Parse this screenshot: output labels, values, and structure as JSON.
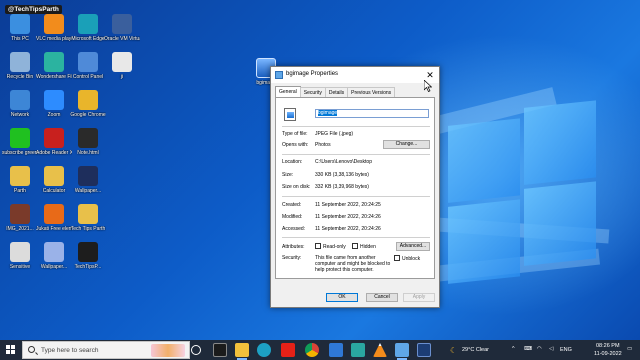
{
  "watermark": "@TechTipsParth",
  "desktop": {
    "icons": [
      {
        "label": "This PC",
        "icon": "this-pc-icon",
        "color": "#3b8fe0"
      },
      {
        "label": "VLC media player",
        "icon": "vlc-icon",
        "color": "#f28c1c"
      },
      {
        "label": "Microsoft Edge",
        "icon": "edge-icon",
        "color": "#1aa0b8"
      },
      {
        "label": "Oracle VM VirtualBox",
        "icon": "virtualbox-icon",
        "color": "#3a5f9d"
      },
      {
        "label": "Recycle Bin",
        "icon": "recycle-bin-icon",
        "color": "#8fb3d9"
      },
      {
        "label": "Wondershare Filmora",
        "icon": "filmora-icon",
        "color": "#2bb3a0"
      },
      {
        "label": "Control Panel",
        "icon": "control-panel-icon",
        "color": "#4f8ad8"
      },
      {
        "label": "ji",
        "icon": "file-icon",
        "color": "#e8e8e8"
      },
      {
        "label": "Network",
        "icon": "network-icon",
        "color": "#3d86d6"
      },
      {
        "label": "Zoom",
        "icon": "zoom-icon",
        "color": "#2d8cff"
      },
      {
        "label": "Google Chrome",
        "icon": "chrome-icon",
        "color": "#e9b52b"
      },
      {
        "label": "subscribe green screen",
        "icon": "image-icon",
        "color": "#20c020"
      },
      {
        "label": "Adobe Reader XI",
        "icon": "adobe-reader-icon",
        "color": "#c8201e"
      },
      {
        "label": "Note.html",
        "icon": "html-file-icon",
        "color": "#2a2a2a"
      },
      {
        "label": "Parth",
        "icon": "folder-icon",
        "color": "#e8c04a"
      },
      {
        "label": "Calculator",
        "icon": "calculator-icon",
        "color": "#e8c04a"
      },
      {
        "label": "Wallpaper...",
        "icon": "wallpaper-icon",
        "color": "#1e2e5c"
      },
      {
        "label": "IMG_2021...",
        "icon": "photo-icon",
        "color": "#7a3a2a"
      },
      {
        "label": "Jukati Free elements",
        "icon": "elements-icon",
        "color": "#e86a18"
      },
      {
        "label": "Tech Tips Parth",
        "icon": "folder-icon",
        "color": "#e8c04a"
      },
      {
        "label": "Sensitive",
        "icon": "document-icon",
        "color": "#dcdcdc"
      },
      {
        "label": "Wallpaper...",
        "icon": "wallpaper-icon",
        "color": "#9ab2e8"
      },
      {
        "label": "TechTipsP...",
        "icon": "logo-icon",
        "color": "#1d1d1d"
      }
    ],
    "selected_file_label": "bgimage"
  },
  "dialog": {
    "title": "bgimage Properties",
    "tabs": [
      "General",
      "Security",
      "Details",
      "Previous Versions"
    ],
    "filename": "bgimage",
    "type_label": "Type of file:",
    "type_value": "JPEG File (.jpeg)",
    "opens_label": "Opens with:",
    "opens_value": "Photos",
    "change_button": "Change...",
    "location_label": "Location:",
    "location_value": "C:\\Users\\Lenovo\\Desktop",
    "size_label": "Size:",
    "size_value": "330 KB (3,38,136 bytes)",
    "size_on_disk_label": "Size on disk:",
    "size_on_disk_value": "332 KB (3,39,968 bytes)",
    "created_label": "Created:",
    "created_value": "11 September 2022, 20:24:25",
    "modified_label": "Modified:",
    "modified_value": "11 September 2022, 20:24:26",
    "accessed_label": "Accessed:",
    "accessed_value": "11 September 2022, 20:24:26",
    "attributes_label": "Attributes:",
    "readonly_label": "Read-only",
    "hidden_label": "Hidden",
    "advanced_button": "Advanced...",
    "security_label": "Security:",
    "security_text": "This file came from another computer and might be blocked to help protect this computer.",
    "unblock_label": "Unblock",
    "ok_button": "OK",
    "cancel_button": "Cancel",
    "apply_button": "Apply"
  },
  "taskbar": {
    "search_placeholder": "Type here to search",
    "weather": "29°C  Clear",
    "language": "ENG",
    "time": "08:26 PM",
    "date": "11-09-2022"
  }
}
